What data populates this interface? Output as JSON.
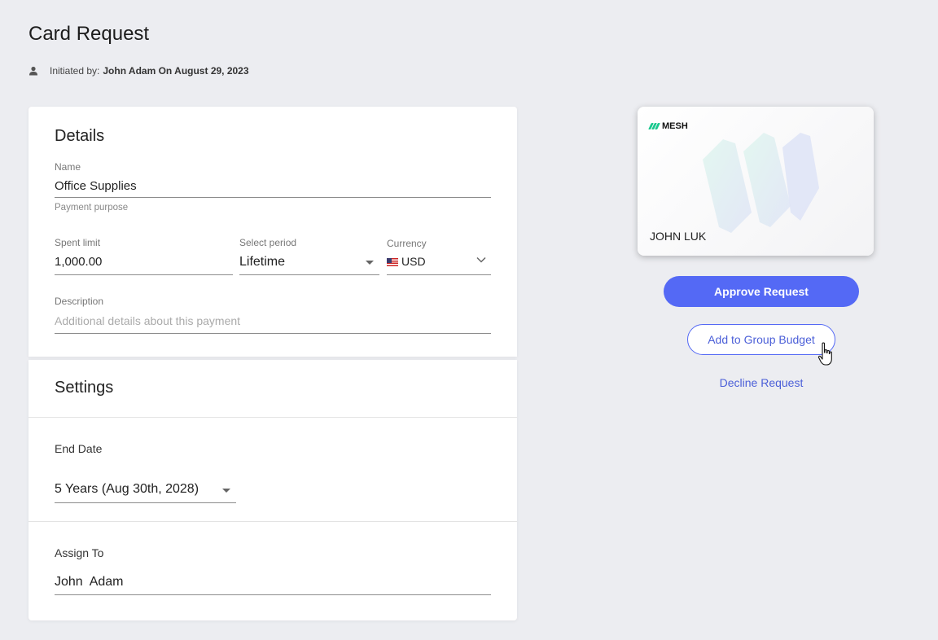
{
  "page": {
    "title": "Card Request",
    "initiated_prefix": "Initiated by:",
    "initiated_value": "John Adam On August 29, 2023"
  },
  "details": {
    "title": "Details",
    "name_label": "Name",
    "name_value": "Office Supplies",
    "name_helper": "Payment purpose",
    "spent_limit_label": "Spent limit",
    "spent_limit_value": "1,000.00",
    "period_label": "Select period",
    "period_value": "Lifetime",
    "currency_label": "Currency",
    "currency_value": "USD",
    "description_label": "Description",
    "description_placeholder": "Additional details about this payment"
  },
  "settings": {
    "title": "Settings",
    "end_date_label": "End Date",
    "end_date_value": "5 Years (Aug 30th, 2028)",
    "assign_label": "Assign To",
    "assign_value": "John  Adam"
  },
  "card": {
    "brand": "MESH",
    "holder": "JOHN LUK",
    "accent": "#19c88e"
  },
  "actions": {
    "approve": "Approve Request",
    "add_group": "Add to Group Budget",
    "decline": "Decline Request",
    "primary_color": "#5469f5"
  },
  "icons": {
    "user": "person-icon",
    "dropdown": "caret-down-icon",
    "chevron": "chevron-down-icon",
    "cursor": "hand-pointer-icon"
  }
}
